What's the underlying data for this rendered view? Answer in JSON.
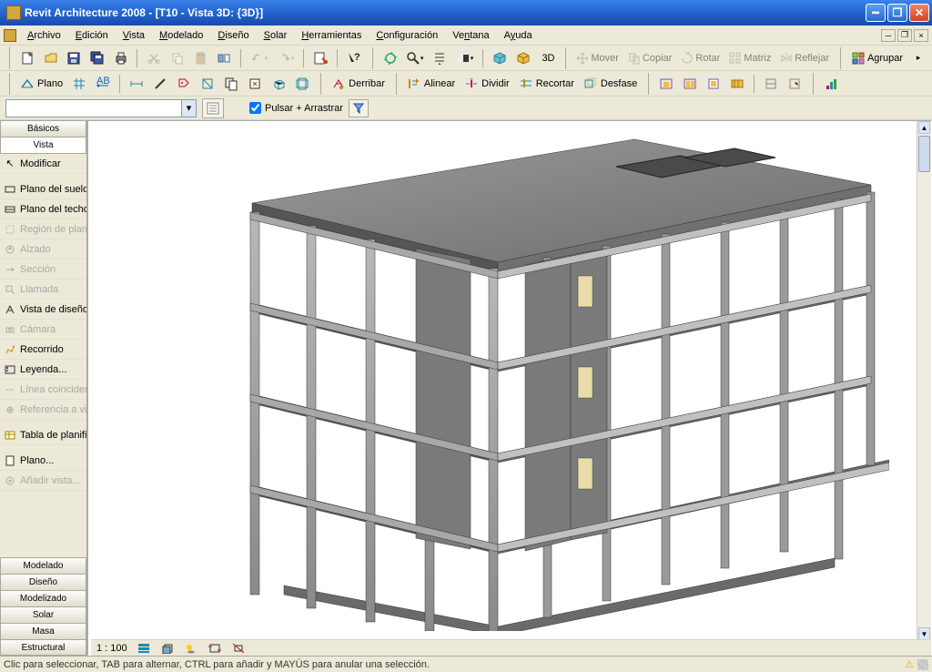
{
  "titlebar": {
    "title": "Revit Architecture 2008 - [T10 - Vista 3D: {3D}]"
  },
  "menu": {
    "items": [
      "Archivo",
      "Edición",
      "Vista",
      "Modelado",
      "Diseño",
      "Solar",
      "Herramientas",
      "Configuración",
      "Ventana",
      "Ayuda"
    ]
  },
  "toolbar1": {
    "d3_label": "3D",
    "mover": "Mover",
    "copiar": "Copiar",
    "rotar": "Rotar",
    "matriz": "Matriz",
    "reflejar": "Reflejar",
    "agrupar": "Agrupar"
  },
  "toolbar2": {
    "plano": "Plano",
    "derribar": "Derribar",
    "alinear": "Alinear",
    "dividir": "Dividir",
    "recortar": "Recortar",
    "desfase": "Desfase"
  },
  "optbar": {
    "pulsar": "Pulsar + Arrastrar"
  },
  "side": {
    "top_tabs": [
      "Básicos",
      "Vista"
    ],
    "items": [
      {
        "label": "Modificar",
        "enabled": true,
        "icon": "cursor"
      },
      {
        "label": "Plano del suelo...",
        "enabled": true,
        "icon": "floor"
      },
      {
        "label": "Plano del techo",
        "enabled": true,
        "icon": "ceiling"
      },
      {
        "label": "Región de plano",
        "enabled": false,
        "icon": "region"
      },
      {
        "label": "Alzado",
        "enabled": false,
        "icon": "elevation"
      },
      {
        "label": "Sección",
        "enabled": false,
        "icon": "section"
      },
      {
        "label": "Llamada",
        "enabled": false,
        "icon": "callout"
      },
      {
        "label": "Vista de diseño",
        "enabled": true,
        "icon": "drafting"
      },
      {
        "label": "Cámara",
        "enabled": false,
        "icon": "camera"
      },
      {
        "label": "Recorrido",
        "enabled": true,
        "icon": "walkthrough"
      },
      {
        "label": "Leyenda...",
        "enabled": true,
        "icon": "legend"
      },
      {
        "label": "Línea coincident",
        "enabled": false,
        "icon": "matchline"
      },
      {
        "label": "Referencia a vis",
        "enabled": false,
        "icon": "viewref"
      },
      {
        "label": "Tabla de planifi",
        "enabled": true,
        "icon": "schedule"
      },
      {
        "label": "Plano...",
        "enabled": true,
        "icon": "sheet"
      },
      {
        "label": "Añadir vista...",
        "enabled": false,
        "icon": "addview"
      }
    ],
    "bot_tabs": [
      "Modelado",
      "Diseño",
      "Modelizado",
      "Solar",
      "Masa",
      "Estructural"
    ]
  },
  "viewctrl": {
    "scale": "1 : 100"
  },
  "status": {
    "msg": "Clic para seleccionar, TAB para alternar, CTRL para añadir y MAYÚS para anular una selección."
  }
}
